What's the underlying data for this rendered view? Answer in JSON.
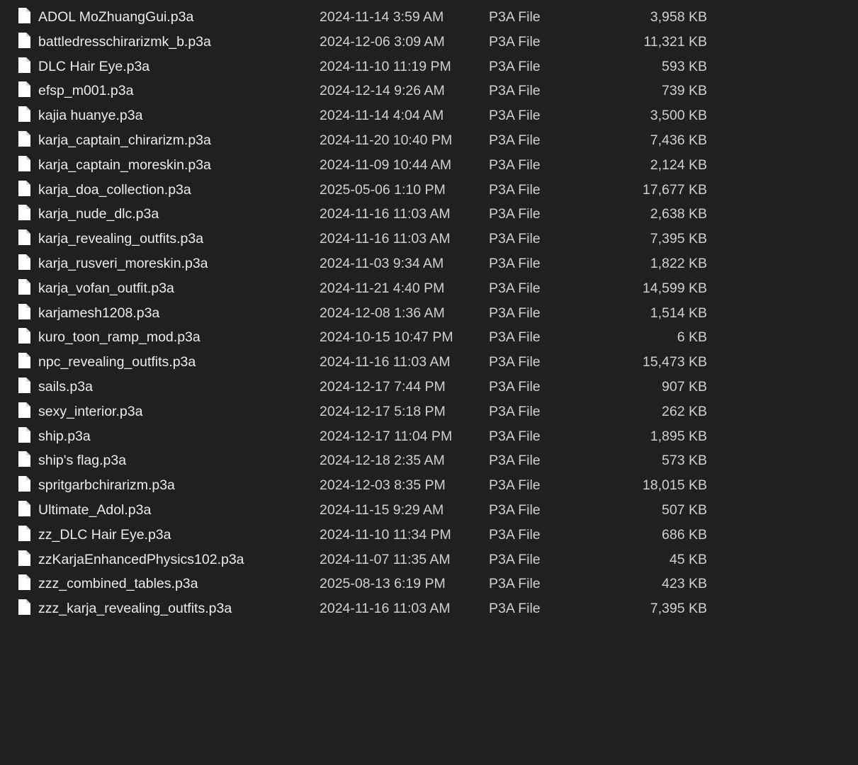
{
  "colors": {
    "background": "#202020",
    "name_text": "#ececec",
    "detail_text": "#d0d0d0",
    "icon_fill": "#ffffff"
  },
  "file_icon": "file-icon",
  "files": [
    {
      "name": "ADOL MoZhuangGui.p3a",
      "date": "2024-11-14 3:59 AM",
      "type": "P3A File",
      "size": "3,958 KB"
    },
    {
      "name": "battledresschirarizmk_b.p3a",
      "date": "2024-12-06 3:09 AM",
      "type": "P3A File",
      "size": "11,321 KB"
    },
    {
      "name": "DLC Hair Eye.p3a",
      "date": "2024-11-10 11:19 PM",
      "type": "P3A File",
      "size": "593 KB"
    },
    {
      "name": "efsp_m001.p3a",
      "date": "2024-12-14 9:26 AM",
      "type": "P3A File",
      "size": "739 KB"
    },
    {
      "name": "kajia huanye.p3a",
      "date": "2024-11-14 4:04 AM",
      "type": "P3A File",
      "size": "3,500 KB"
    },
    {
      "name": "karja_captain_chirarizm.p3a",
      "date": "2024-11-20 10:40 PM",
      "type": "P3A File",
      "size": "7,436 KB"
    },
    {
      "name": "karja_captain_moreskin.p3a",
      "date": "2024-11-09 10:44 AM",
      "type": "P3A File",
      "size": "2,124 KB"
    },
    {
      "name": "karja_doa_collection.p3a",
      "date": "2025-05-06 1:10 PM",
      "type": "P3A File",
      "size": "17,677 KB"
    },
    {
      "name": "karja_nude_dlc.p3a",
      "date": "2024-11-16 11:03 AM",
      "type": "P3A File",
      "size": "2,638 KB"
    },
    {
      "name": "karja_revealing_outfits.p3a",
      "date": "2024-11-16 11:03 AM",
      "type": "P3A File",
      "size": "7,395 KB"
    },
    {
      "name": "karja_rusveri_moreskin.p3a",
      "date": "2024-11-03 9:34 AM",
      "type": "P3A File",
      "size": "1,822 KB"
    },
    {
      "name": "karja_vofan_outfit.p3a",
      "date": "2024-11-21 4:40 PM",
      "type": "P3A File",
      "size": "14,599 KB"
    },
    {
      "name": "karjamesh1208.p3a",
      "date": "2024-12-08 1:36 AM",
      "type": "P3A File",
      "size": "1,514 KB"
    },
    {
      "name": "kuro_toon_ramp_mod.p3a",
      "date": "2024-10-15 10:47 PM",
      "type": "P3A File",
      "size": "6 KB"
    },
    {
      "name": "npc_revealing_outfits.p3a",
      "date": "2024-11-16 11:03 AM",
      "type": "P3A File",
      "size": "15,473 KB"
    },
    {
      "name": "sails.p3a",
      "date": "2024-12-17 7:44 PM",
      "type": "P3A File",
      "size": "907 KB"
    },
    {
      "name": "sexy_interior.p3a",
      "date": "2024-12-17 5:18 PM",
      "type": "P3A File",
      "size": "262 KB"
    },
    {
      "name": "ship.p3a",
      "date": "2024-12-17 11:04 PM",
      "type": "P3A File",
      "size": "1,895 KB"
    },
    {
      "name": "ship's flag.p3a",
      "date": "2024-12-18 2:35 AM",
      "type": "P3A File",
      "size": "573 KB"
    },
    {
      "name": "spritgarbchirarizm.p3a",
      "date": "2024-12-03 8:35 PM",
      "type": "P3A File",
      "size": "18,015 KB"
    },
    {
      "name": "Ultimate_Adol.p3a",
      "date": "2024-11-15 9:29 AM",
      "type": "P3A File",
      "size": "507 KB"
    },
    {
      "name": "zz_DLC Hair Eye.p3a",
      "date": "2024-11-10 11:34 PM",
      "type": "P3A File",
      "size": "686 KB"
    },
    {
      "name": "zzKarjaEnhancedPhysics102.p3a",
      "date": "2024-11-07 11:35 AM",
      "type": "P3A File",
      "size": "45 KB"
    },
    {
      "name": "zzz_combined_tables.p3a",
      "date": "2025-08-13 6:19 PM",
      "type": "P3A File",
      "size": "423 KB"
    },
    {
      "name": "zzz_karja_revealing_outfits.p3a",
      "date": "2024-11-16 11:03 AM",
      "type": "P3A File",
      "size": "7,395 KB"
    }
  ]
}
